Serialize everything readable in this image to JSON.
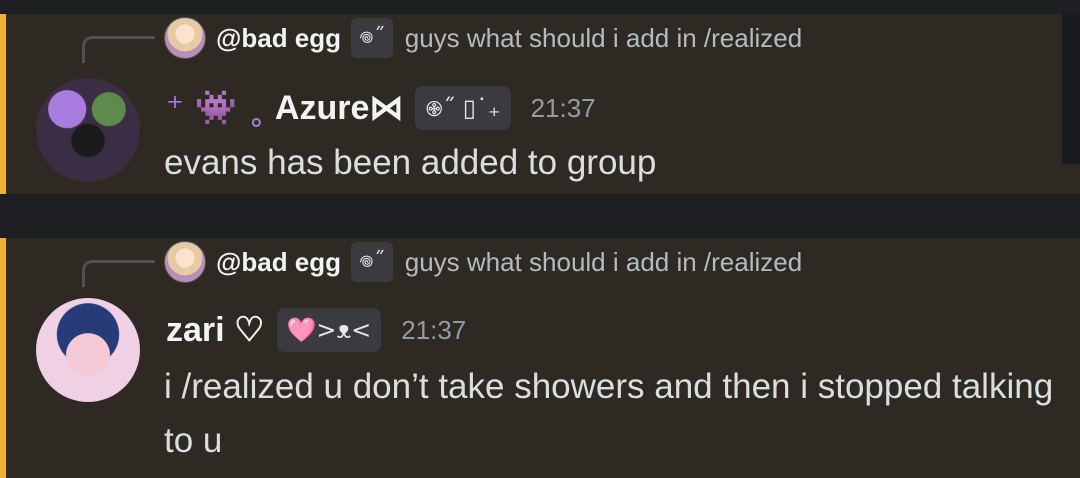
{
  "messages": [
    {
      "reply": {
        "username": "@bad egg",
        "tag": "𖦹˝",
        "text": "guys what should i add in /realized"
      },
      "author": {
        "prefix": "⁺ 👾 ˳",
        "name": "Azure⋈",
        "badge": "𖢄˝ ▯˙₊"
      },
      "timestamp": "21:37",
      "content": "evans has been added to group"
    },
    {
      "reply": {
        "username": "@bad egg",
        "tag": "𖦹˝",
        "text": "guys what should i add in /realized"
      },
      "author": {
        "prefix": "",
        "name": "zari ♡",
        "badge": "🩷>ᴥ<"
      },
      "timestamp": "21:37",
      "content": "i /realized u don’t take showers and then i stopped talking to u"
    }
  ]
}
